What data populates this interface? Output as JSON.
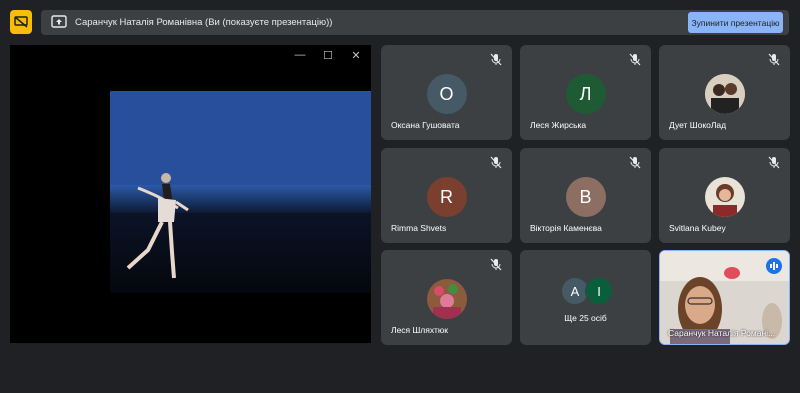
{
  "banner": {
    "text": "Саранчук Наталія Романівна (Ви (показуєте презентацію))",
    "stop_label": "Зупинити презентацію"
  },
  "presentation": {
    "controls": [
      "—",
      "☐",
      "✕"
    ]
  },
  "participants": [
    {
      "initial": "О",
      "name": "Оксана Гушовата",
      "color": "#455a64",
      "muted": true
    },
    {
      "initial": "Л",
      "name": "Леся Жирська",
      "color": "#1e5b35",
      "muted": true
    },
    {
      "initial": "",
      "name": "Дует ШокоЛад",
      "photo": true,
      "muted": true
    },
    {
      "initial": "R",
      "name": "Rimma Shvets",
      "color": "#7b3f2f",
      "muted": true
    },
    {
      "initial": "В",
      "name": "Вікторія Каменєва",
      "color": "#8d6e63",
      "muted": true
    },
    {
      "initial": "",
      "name": "Svitlana Kubey",
      "photo": true,
      "muted": true
    },
    {
      "initial": "",
      "name": "Леся Шляхтюк",
      "photo": true,
      "muted": true
    }
  ],
  "more": {
    "initials": [
      "А",
      "І"
    ],
    "colors": [
      "#455a64",
      "#0b5e3b"
    ],
    "label": "Ще 25 осіб"
  },
  "self": {
    "name": "Саранчук Наталія Романі..."
  },
  "accent": "#8ab4f8"
}
